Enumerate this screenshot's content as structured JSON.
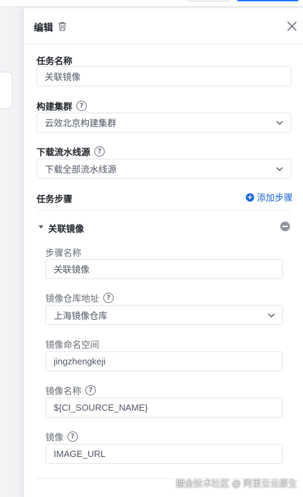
{
  "drawer": {
    "title": "编辑"
  },
  "form": {
    "task_name_label": "任务名称",
    "task_name_value": "关联镜像",
    "build_cluster_label": "构建集群",
    "build_cluster_value": "云效北京构建集群",
    "download_source_label": "下载流水线源",
    "download_source_value": "下载全部流水线源",
    "task_steps_label": "任务步骤",
    "add_step_label": "添加步骤"
  },
  "step": {
    "title": "关联镜像",
    "step_name_label": "步骤名称",
    "step_name_value": "关联镜像",
    "repo_address_label": "镜像仓库地址",
    "repo_address_value": "上海镜像仓库",
    "namespace_label": "镜像命名空间",
    "namespace_value": "jingzhengkeji",
    "image_name_label": "镜像名称",
    "image_name_value": "${CI_SOURCE_NAME}",
    "image_label": "镜像",
    "image_value": "IMAGE_URL"
  },
  "watermark": "掘金技术社区 @ 阿里云云原生",
  "colors": {
    "accent": "#1366d6",
    "text_primary": "#1f2329",
    "text_secondary": "#646a73",
    "border": "#e3e5ea"
  },
  "icons": {
    "trash": "trash-icon",
    "close": "close-icon",
    "help": "help-icon",
    "chevron": "chevron-down-icon",
    "add": "plus-circle-icon",
    "collapse": "caret-down-icon",
    "remove": "minus-circle-icon"
  }
}
